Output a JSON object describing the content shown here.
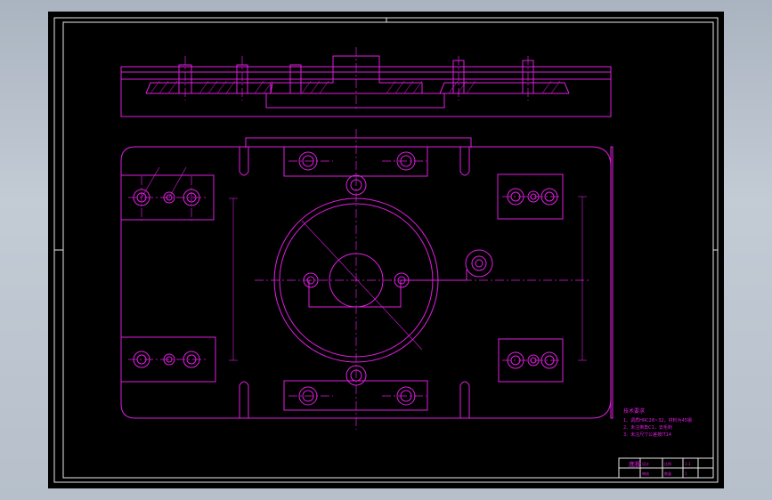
{
  "drawing": {
    "colors": {
      "background": "#000000",
      "lines": "#e01ee0",
      "frame": "#e8e8e8",
      "window_bg": "#b6bfca"
    },
    "notes": {
      "heading": "技术要求",
      "lines": [
        "1、调质HRC28~32，材料为45钢",
        "2、未注倒角C1，去毛刺",
        "3、未注尺寸公差按IT14"
      ]
    },
    "title_block": {
      "title": "底板",
      "cells": [
        "设计",
        "审核",
        "比例",
        "1:1",
        "数量",
        "1"
      ]
    }
  }
}
